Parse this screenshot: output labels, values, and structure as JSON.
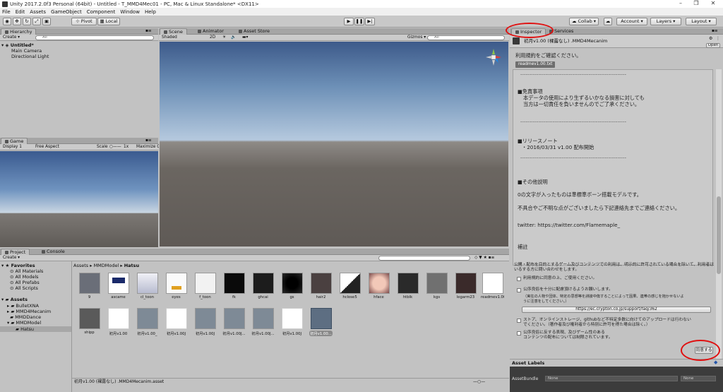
{
  "window": {
    "title": "Unity 2017.2.0f3 Personal (64bit) - Untitled - T_MMD4Mec01 - PC, Mac & Linux Standalone* <DX11>",
    "controls": [
      "–",
      "❐",
      "✕"
    ]
  },
  "menu": [
    "File",
    "Edit",
    "Assets",
    "GameObject",
    "Component",
    "Window",
    "Help"
  ],
  "toolbar": {
    "pivot": "Pivot",
    "local": "Local",
    "collab": "Collab ▾",
    "account": "Account ▾",
    "layers": "Layers ▾",
    "layout": "Layout ▾"
  },
  "hierarchy": {
    "tab": "Hierarchy",
    "create": "Create ▾",
    "search_placeholder": "All",
    "scene": "Untitled*",
    "items": [
      "Main Camera",
      "Directional Light"
    ]
  },
  "scene": {
    "tabs": [
      "Scene",
      "Animator",
      "Asset Store"
    ],
    "shading": "Shaded",
    "mode_2d": "2D",
    "gizmos": "Gizmos ▾",
    "search_placeholder": "All"
  },
  "game": {
    "tab": "Game",
    "display": "Display 1",
    "aspect": "Free Aspect",
    "scale_label": "Scale",
    "scale_value": "1x",
    "maximize": "Maximize C"
  },
  "project": {
    "tabs": [
      "Project",
      "Console"
    ],
    "create": "Create ▾",
    "breadcrumb": [
      "Assets",
      "MMDModel",
      "Hatsu"
    ],
    "favorites_label": "Favorites",
    "favorites": [
      "All Materials",
      "All Models",
      "All Prefabs",
      "All Scripts"
    ],
    "assets_label": "Assets",
    "folders": [
      "BulletXNA",
      "MMD4Mecanim",
      "MMDDance",
      "MMDModel"
    ],
    "subfolder": "Hatsu",
    "grid_row1": [
      "9",
      "ascame",
      "cl_toon",
      "eyes",
      "f_toon",
      "fk",
      "ghcai",
      "gs",
      "hair2",
      "hclose5",
      "hface",
      "htblk",
      "kgs",
      "legarm23",
      "readmev1.00"
    ],
    "grid_row2": [
      "shipp",
      "初月v1.00",
      "初月v1.00_",
      "初月v1.00J",
      "初月v1.00J",
      "初月v1.00J...",
      "初月v1.00J...",
      "初月v1.00J",
      "初月v1.00..."
    ],
    "status": "初月v1.00 (裸露なし) .MMD4Mecanim.asset"
  },
  "inspector": {
    "tabs": [
      "Inspector",
      "Services"
    ],
    "title": "初月v1.00 (裸露なし) .MMD4Mecanim",
    "open": "Open",
    "notice": "利用規約をご確認ください。",
    "file_tag": "readmev1.00.txt",
    "separator": "-----------------------------------------------------------",
    "disclaimer_head": "■免責事項",
    "disclaimer_1": "本データの使用により生ずるいかなる損害に対しても",
    "disclaimer_2": "当方は一切責任を負いませんのでご了承ください。",
    "release_head": "■リリースノート",
    "release_1": "・2016/03/31 v1.00 配布開始",
    "other_head": "■その他説明",
    "other_1": "0の文字が入ったものは準標準ボーン搭載モデルです。",
    "other_2": "不具合やご不明な点がございましたら下記連絡先までご連絡ください。",
    "twitter": "twitter: https://twitter.com/Flamemaple_",
    "misc": "補註",
    "terms_1": "公開・配布を目的とするゲーム及びコンテンツでの利用は、明示的に許可されている場合を除いて、利用者は",
    "terms_2": "いるする方に問い合わせをします。",
    "check_1": "利用規約に同意の上、ご使用ください。",
    "check_2": "公序良俗を十分に配慮頂けるようお願いします。",
    "check_2_sub1": "（実在の人物や団体、特定の思想等を誹謗中傷することによって因果、連帯の感じを抱かせないよ",
    "check_2_sub2": "うに注意をしてください。）",
    "link": "https://ec.crypton.co.jp/support/faq/362",
    "check_3": "ストア、オンラインストレージ、githubなど不特定多数に向けてのアップロードは行わない",
    "check_3_sub": "でください。（著作者及び権利者から特別に許可を得た場合は除く。）",
    "check_4": "公序良俗に反する表現、及びゲーム性のある",
    "check_4_sub": "コンテンツの配布については制限されています。",
    "agree": "同意する",
    "asset_labels": "Asset Labels",
    "assetbundle": "AssetBundle",
    "none1": "None",
    "none2": "None"
  },
  "colors": {
    "thumb_9": "#6a6e78",
    "thumb_ascame": "#ffffff",
    "thumb_cl_toon": "#d8dae6",
    "thumb_eyes": "#fafafa",
    "thumb_f_toon": "#f2f2f2",
    "thumb_fk": "#0a0a0a",
    "thumb_ghcai": "#1c1c1c",
    "thumb_gs": "#101010",
    "thumb_hair2": "#4a4040",
    "thumb_hclose5": "#e8e8e8",
    "thumb_hface": "#e8b4a8",
    "thumb_htblk": "#2a2a2a",
    "thumb_kgs": "#707070",
    "thumb_legarm23": "#3a2a2a",
    "thumb_readme": "#ffffff",
    "thumb_shipp": "#5a5a5a",
    "annotation": "#e01010"
  }
}
